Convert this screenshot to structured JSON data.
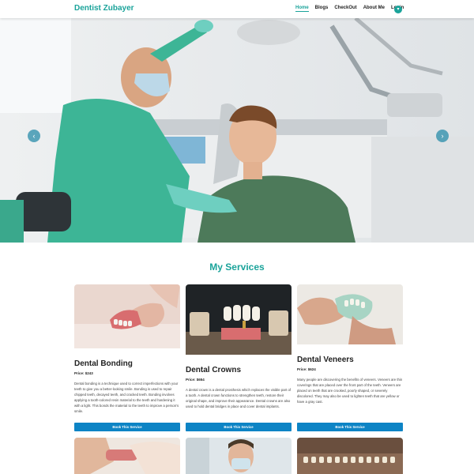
{
  "brand": "Dentist Zubayer",
  "nav": {
    "items": [
      "Home",
      "Blogs",
      "CheckOut",
      "About Me",
      "Login"
    ],
    "active": "Home"
  },
  "services": {
    "title": "My Services",
    "book_label": "Book This Service",
    "cards": [
      {
        "name": "Dental Bonding",
        "price": "Price: $243",
        "description": "Dental bonding is a technique used to correct imperfections with your teeth to give you a better-looking smile. Bonding is used to repair chipped teeth, decayed teeth, and cracked teeth. Bonding involves applying a tooth-colored resin material to the teeth and hardening it with a light. This bonds the material to the teeth to improve a person's smile."
      },
      {
        "name": "Dental Crowns",
        "price": "Price: $654",
        "description": "A dental crown is a dental prosthesis which replaces the visible part of a tooth. A dental crown functions to strengthen teeth, restore their original shape, and improve their appearance. Dental crowns are also used to hold dental bridges in place and cover dental implants."
      },
      {
        "name": "Dental Veneers",
        "price": "Price: $624",
        "description": "Many people are discovering the benefits of veneers. Veneers are thin coverings that are placed over the front part of the teeth. Veneers are placed on teeth that are crooked, poorly shaped, or severely discolored. They may also be used to lighten teeth that are yellow or have a gray cast."
      }
    ]
  },
  "colors": {
    "accent": "#1aa39a",
    "button": "#0d84c5"
  }
}
